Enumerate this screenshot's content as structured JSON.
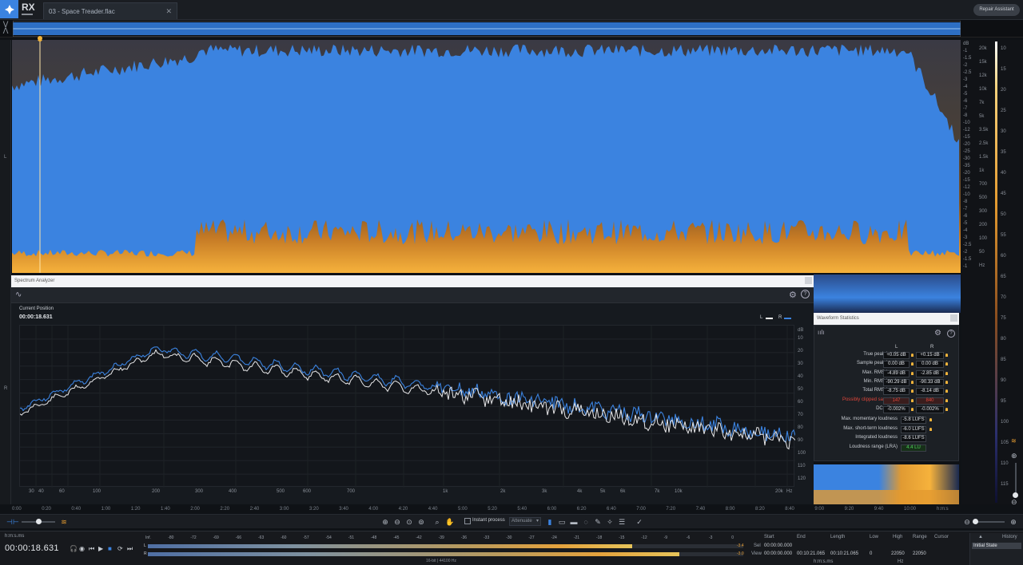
{
  "app": {
    "logo_text": "RX",
    "file_tab": "03 - Space Treader.flac",
    "repair_assistant": "Repair Assistant"
  },
  "channels": {
    "left": "L",
    "right": "R"
  },
  "db_scale": [
    "dB",
    "-1",
    "-1.5",
    "-2",
    "-2.5",
    "-3",
    "-4",
    "-5",
    "-6",
    "-7",
    "-8",
    "-10",
    "-12",
    "-15",
    "-20",
    "-25",
    "-30",
    "-35",
    "-20",
    "-15",
    "-12",
    "-10",
    "-8",
    "-7",
    "-6",
    "-5",
    "-4",
    "-3",
    "-2.5",
    "-2",
    "-1.5",
    "-1"
  ],
  "hz_scale": [
    "20k",
    "15k",
    "12k",
    "10k",
    "7k",
    "5k",
    "3.5k",
    "2.5k",
    "1.5k",
    "1k",
    "700",
    "500",
    "300",
    "200",
    "100",
    "50",
    "Hz"
  ],
  "color_scale": [
    "10",
    "15",
    "20",
    "25",
    "30",
    "35",
    "40",
    "45",
    "50",
    "55",
    "60",
    "65",
    "70",
    "75",
    "80",
    "85",
    "90",
    "95",
    "100",
    "105",
    "110",
    "115"
  ],
  "spectrum_analyzer": {
    "title": "Spectrum Analyzer",
    "current_position_label": "Current Position",
    "current_position": "00:00:18.631",
    "legend_l": "L",
    "legend_r": "R",
    "db_unit": "dB",
    "db_ticks": [
      "10",
      "20",
      "30",
      "40",
      "50",
      "60",
      "70",
      "80",
      "90",
      "100",
      "110",
      "120"
    ],
    "freq_ticks": [
      "30",
      "40",
      "60",
      "100",
      "200",
      "300",
      "400",
      "500",
      "600",
      "700",
      "1k",
      "2k",
      "3k",
      "4k",
      "5k",
      "6k",
      "7k",
      "10k",
      "20k",
      "Hz"
    ]
  },
  "waveform_stats": {
    "title": "Waveform Statistics",
    "col_l": "L",
    "col_r": "R",
    "rows": [
      {
        "label": "True peak level",
        "l": "+0.05 dB",
        "r": "+0.15 dB"
      },
      {
        "label": "Sample peak level",
        "l": "0.00 dB",
        "r": "0.00 dB"
      },
      {
        "label": "Max. RMS level",
        "l": "-4.89 dB",
        "r": "-2.85 dB"
      },
      {
        "label": "Min. RMS level",
        "l": "-90.29 dB",
        "r": "-90.33 dB"
      },
      {
        "label": "Total RMS level",
        "l": "-8.75 dB",
        "r": "-8.14 dB"
      },
      {
        "label": "Possibly clipped samples",
        "l": "147",
        "r": "840"
      },
      {
        "label": "DC offset",
        "l": "-0.002%",
        "r": "-0.002%"
      }
    ],
    "loudness": [
      {
        "label": "Max. momentary loudness",
        "v": "-5.8 LUFS"
      },
      {
        "label": "Max. short-term loudness",
        "v": "-6.0 LUFS"
      },
      {
        "label": "Integrated loudness",
        "v": "-8.6 LUFS"
      },
      {
        "label": "Loudness range (LRA)",
        "v": "4.4 LU"
      }
    ]
  },
  "time_ruler": [
    "0:00",
    "0:20",
    "0:40",
    "1:00",
    "1:20",
    "1:40",
    "2:00",
    "2:20",
    "2:40",
    "3:00",
    "3:20",
    "3:40",
    "4:00",
    "4:20",
    "4:40",
    "5:00",
    "5:20",
    "5:40",
    "6:00",
    "6:20",
    "6:40",
    "7:00",
    "7:20",
    "7:40",
    "8:00",
    "8:20",
    "8:40",
    "9:00",
    "9:20",
    "9:40",
    "10:00",
    "h:m:s"
  ],
  "toolbar": {
    "instant_process": "Instant process",
    "attenuate": "Attenuate"
  },
  "footer": {
    "tc_format": "h:m:s.ms",
    "timecode": "00:00:18.631",
    "meter_ticks": [
      "Inf.",
      "-80",
      "-72",
      "-69",
      "-66",
      "-63",
      "-60",
      "-57",
      "-54",
      "-51",
      "-48",
      "-45",
      "-42",
      "-39",
      "-36",
      "-33",
      "-30",
      "-27",
      "-24",
      "-21",
      "-18",
      "-15",
      "-12",
      "-9",
      "-6",
      "-3",
      "0"
    ],
    "meter_l_label": "L",
    "meter_r_label": "R",
    "meter_l_val": "-3.4",
    "meter_r_val": "-3.0",
    "format": "16-bit | 44100 Hz",
    "sel_headers": [
      "Start",
      "End",
      "Length",
      "Low",
      "High",
      "Range",
      "Cursor"
    ],
    "sel_label": "Sel",
    "view_label": "View",
    "sel_start": "00:00:00.000",
    "view_start": "00:00:00.000",
    "view_end": "00:10:21.065",
    "view_length": "00:10:21.065",
    "view_low": "0",
    "view_high": "22050",
    "view_range": "22050",
    "hz_unit": "Hz",
    "hms_unit": "h:m:s.ms",
    "history_title": "History",
    "history_item": "Initial State"
  },
  "colors": {
    "waveform": "#3b83e0",
    "spectro_hot": "#f2a63a",
    "accent": "#f0b23a",
    "clipped": "#e0463a"
  }
}
